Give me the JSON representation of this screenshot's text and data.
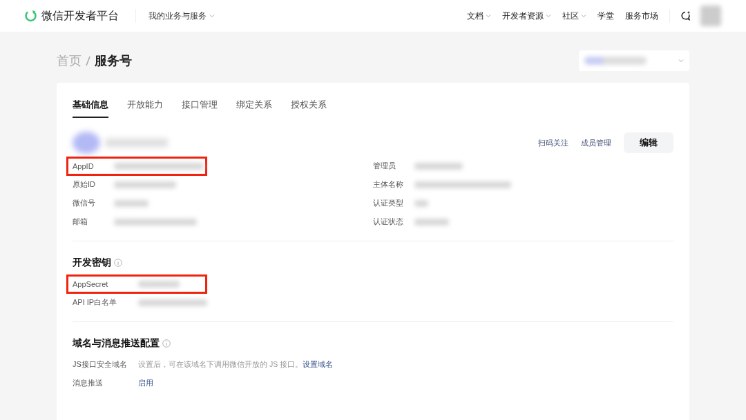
{
  "header": {
    "logo_text": "微信开发者平台",
    "menu": "我的业务与服务",
    "nav": [
      {
        "label": "文档",
        "dropdown": true
      },
      {
        "label": "开发者资源",
        "dropdown": true
      },
      {
        "label": "社区",
        "dropdown": true
      },
      {
        "label": "学堂",
        "dropdown": false
      },
      {
        "label": "服务市场",
        "dropdown": false
      }
    ]
  },
  "breadcrumb": [
    "首页",
    "服务号"
  ],
  "tabs": [
    {
      "label": "基础信息",
      "selected": true
    },
    {
      "label": "开放能力",
      "selected": false
    },
    {
      "label": "接口管理",
      "selected": false
    },
    {
      "label": "绑定关系",
      "selected": false
    },
    {
      "label": "授权关系",
      "selected": false
    }
  ],
  "profile_actions": {
    "links": [
      "扫码关注",
      "成员管理"
    ],
    "button": "编辑"
  },
  "info_left": [
    {
      "label": "AppID",
      "highlighted": true
    },
    {
      "label": "原始ID",
      "highlighted": false
    },
    {
      "label": "微信号",
      "highlighted": false
    },
    {
      "label": "邮箱",
      "highlighted": false
    }
  ],
  "info_right": [
    {
      "label": "管理员",
      "highlighted": false
    },
    {
      "label": "主体名称",
      "highlighted": false
    },
    {
      "label": "认证类型",
      "highlighted": false
    },
    {
      "label": "认证状态",
      "highlighted": false
    }
  ],
  "sections": [
    {
      "title": "开发密钥",
      "rows": [
        {
          "kind": "redacted",
          "label": "AppSecret",
          "highlighted": true
        },
        {
          "kind": "redacted",
          "label": "API IP白名单",
          "highlighted": false
        }
      ]
    },
    {
      "title": "域名与消息推送配置",
      "rows": [
        {
          "kind": "hint",
          "label": "JS接口安全域名",
          "hint": "设置后，可在该域名下调用微信开放的 JS 接口。",
          "link": "设置域名",
          "highlighted": false
        },
        {
          "kind": "link",
          "label": "消息推送",
          "link": "启用",
          "highlighted": false
        }
      ]
    }
  ]
}
